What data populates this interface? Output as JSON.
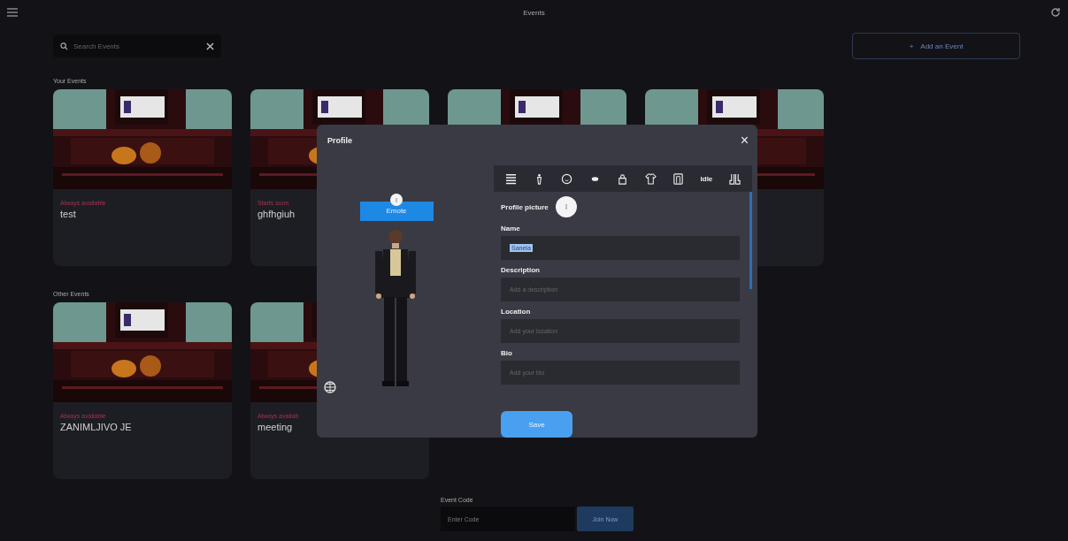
{
  "top_bar": {
    "title": "Events"
  },
  "search": {
    "placeholder": "Search Events"
  },
  "add_button": {
    "icon": "+",
    "label": "Add an Event"
  },
  "your_events": {
    "heading": "Your Events",
    "cards": [
      {
        "status": "Always available",
        "title": "test"
      },
      {
        "status": "Starts soon",
        "title": "ghfhgiuh"
      },
      {
        "kind": "picture"
      },
      {
        "kind": "picture"
      }
    ]
  },
  "other_events": {
    "heading": "Other Events",
    "cards": [
      {
        "status": "Always available",
        "title": "ZANIMLJIVO JE"
      },
      {
        "status": "Always availab",
        "title": "meeting"
      }
    ]
  },
  "event_code": {
    "label": "Event Code",
    "placeholder": "Enter Code",
    "button": "Join Now"
  },
  "profile_dialog": {
    "title": "Profile",
    "close": "×",
    "emote_button": "Emote",
    "toolbar_label": "Idle",
    "fields": [
      {
        "kind": "picture",
        "label": "Profile picture"
      },
      {
        "kind": "input",
        "label": "Name",
        "value": "Sanela",
        "value_selected": true
      },
      {
        "kind": "input",
        "label": "Description",
        "placeholder": "Add a description"
      },
      {
        "kind": "input",
        "label": "Location",
        "placeholder": "Add your location"
      },
      {
        "kind": "input",
        "label": "Bio",
        "placeholder": "Add your bio"
      }
    ],
    "save": "Save"
  }
}
